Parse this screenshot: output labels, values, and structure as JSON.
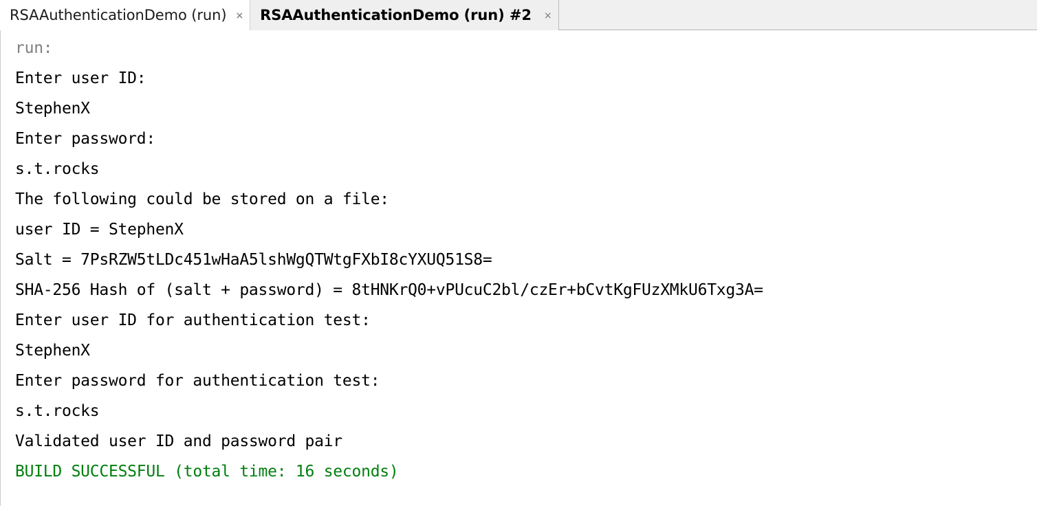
{
  "window": {
    "type": "ide-output-console",
    "colors": {
      "tabbar_bg": "#f0f0f0",
      "console_bg": "#ffffff",
      "text": "#000000",
      "muted_text": "#808080",
      "success_text": "#007f0e"
    }
  },
  "tabs": [
    {
      "label": "RSAAuthenticationDemo (run)",
      "close_glyph": "×",
      "active": false
    },
    {
      "label": "RSAAuthenticationDemo (run) #2",
      "close_glyph": "×",
      "active": true
    }
  ],
  "console": {
    "lines": [
      {
        "text": "run:",
        "style": "muted"
      },
      {
        "text": "Enter user ID:",
        "style": "normal"
      },
      {
        "text": "StephenX",
        "style": "normal"
      },
      {
        "text": "Enter password:",
        "style": "normal"
      },
      {
        "text": "s.t.rocks",
        "style": "normal"
      },
      {
        "text": "The following could be stored on a file:",
        "style": "normal"
      },
      {
        "text": "user ID = StephenX",
        "style": "normal"
      },
      {
        "text": "Salt = 7PsRZW5tLDc451wHaA5lshWgQTWtgFXbI8cYXUQ51S8=",
        "style": "normal"
      },
      {
        "text": "SHA-256 Hash of (salt + password) = 8tHNKrQ0+vPUcuC2bl/czEr+bCvtKgFUzXMkU6Txg3A=",
        "style": "normal"
      },
      {
        "text": "Enter user ID for authentication test:",
        "style": "normal"
      },
      {
        "text": "StephenX",
        "style": "normal"
      },
      {
        "text": "Enter password for authentication test:",
        "style": "normal"
      },
      {
        "text": "s.t.rocks",
        "style": "normal"
      },
      {
        "text": "Validated user ID and password pair",
        "style": "normal"
      },
      {
        "text": "BUILD SUCCESSFUL (total time: 16 seconds)",
        "style": "ok"
      }
    ]
  }
}
